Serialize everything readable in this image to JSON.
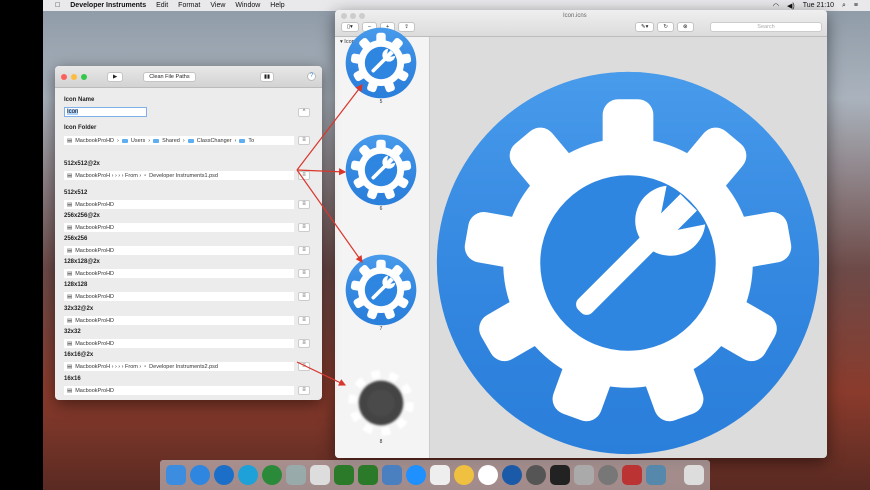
{
  "menubar": {
    "app": "Developer Instruments",
    "items": [
      "Edit",
      "Format",
      "View",
      "Window",
      "Help"
    ],
    "clock": "Tue 21:10"
  },
  "left_window": {
    "run_icon": "play-icon",
    "clean_button": "Clean File Paths",
    "help": "?",
    "icon_name_label": "Icon Name",
    "icon_name_value": "Icon",
    "stepper": "^",
    "icon_folder_label": "Icon Folder",
    "icon_folder_path": [
      "MacbookProHD",
      "Users",
      "Shared",
      "ClassChanger",
      "To"
    ],
    "rows": [
      {
        "label": "512x512@2x",
        "path": "MacbookProH › › › › From ›",
        "file": "Developer Instruments1.psd"
      },
      {
        "label": "512x512",
        "path": "MacbookProHD",
        "file": ""
      },
      {
        "label": "256x256@2x",
        "path": "MacbookProHD",
        "file": ""
      },
      {
        "label": "256x256",
        "path": "MacbookProHD",
        "file": ""
      },
      {
        "label": "128x128@2x",
        "path": "MacbookProHD",
        "file": ""
      },
      {
        "label": "128x128",
        "path": "MacbookProHD",
        "file": ""
      },
      {
        "label": "32x32@2x",
        "path": "MacbookProHD",
        "file": ""
      },
      {
        "label": "32x32",
        "path": "MacbookProHD",
        "file": ""
      },
      {
        "label": "16x16@2x",
        "path": "MacbookProH › › › › From ›",
        "file": "Developer Instruments2.psd"
      },
      {
        "label": "16x16",
        "path": "MacbookProHD",
        "file": ""
      }
    ]
  },
  "preview": {
    "title": "Icon.icns",
    "sidebar_header": "Icon.icns",
    "search_placeholder": "Search",
    "thumbs": [
      "5",
      "6",
      "7",
      "8"
    ]
  },
  "colors": {
    "accent": "#2f86e0",
    "arrow": "#d9362b"
  }
}
